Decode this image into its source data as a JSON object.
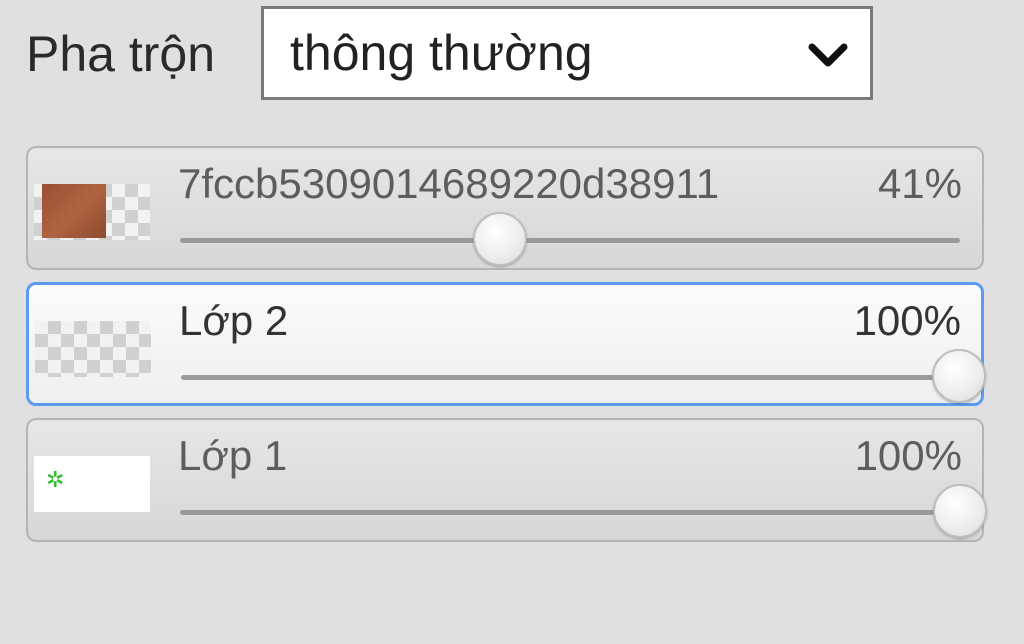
{
  "blend": {
    "label": "Pha trộn",
    "selected": "thông thường"
  },
  "layers": [
    {
      "name": "7fccb5309014689220d38911",
      "opacity_label": "41%",
      "opacity": 0.41,
      "selected": false,
      "thumbnail": "brown-texture-thumbnail"
    },
    {
      "name": "Lớp 2",
      "opacity_label": "100%",
      "opacity": 1.0,
      "selected": true,
      "thumbnail": "transparent-thumbnail"
    },
    {
      "name": "Lớp 1",
      "opacity_label": "100%",
      "opacity": 1.0,
      "selected": false,
      "thumbnail": "white-green-thumbnail"
    }
  ],
  "colors": {
    "selection_border": "#5b9bf0",
    "panel_bg": "#e0e0e0"
  }
}
